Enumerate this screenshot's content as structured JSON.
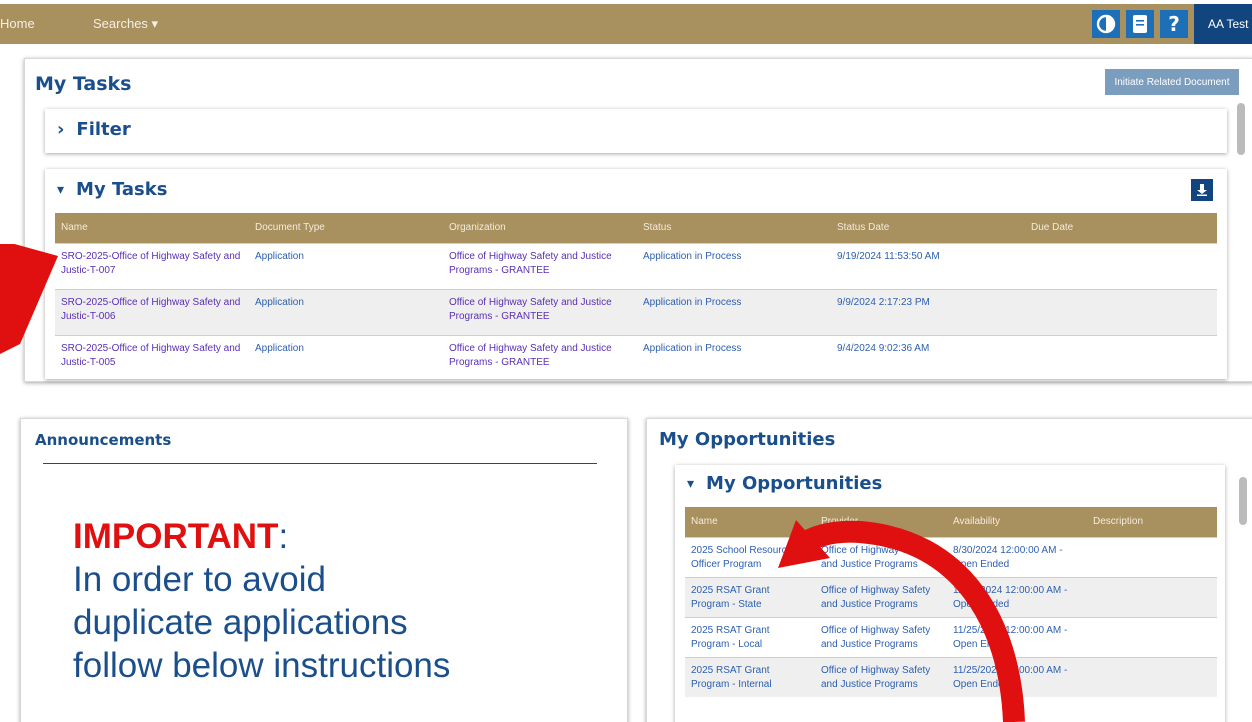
{
  "nav": {
    "home": "Home",
    "searches": "Searches ▾",
    "user": "AA Test",
    "icons": [
      "contrast-icon",
      "book-icon",
      "help-icon"
    ]
  },
  "tasks_panel": {
    "title": "My Tasks",
    "initiate_button": "Initiate Related Document",
    "filter_label": "Filter",
    "subpanel_title": "My Tasks",
    "columns": [
      "Name",
      "Document Type",
      "Organization",
      "Status",
      "Status Date",
      "Due Date"
    ],
    "rows": [
      {
        "name": "SRO-2025-Office of Highway Safety and Justic-T-007",
        "doc_type": "Application",
        "org": "Office of Highway Safety and Justice Programs - GRANTEE",
        "status": "Application in Process",
        "status_date": "9/19/2024 11:53:50 AM",
        "due_date": ""
      },
      {
        "name": "SRO-2025-Office of Highway Safety and Justic-T-006",
        "doc_type": "Application",
        "org": "Office of Highway Safety and Justice Programs - GRANTEE",
        "status": "Application in Process",
        "status_date": "9/9/2024 2:17:23 PM",
        "due_date": ""
      },
      {
        "name": "SRO-2025-Office of Highway Safety and Justic-T-005",
        "doc_type": "Application",
        "org": "Office of Highway Safety and Justice Programs - GRANTEE",
        "status": "Application in Process",
        "status_date": "9/4/2024 9:02:36 AM",
        "due_date": ""
      }
    ]
  },
  "announcements": {
    "title": "Announcements",
    "important": "IMPORTANT",
    "colon": ":",
    "lines": [
      "In order to avoid",
      "duplicate applications",
      "follow below instructions"
    ]
  },
  "opportunities": {
    "title": "My Opportunities",
    "subpanel_title": "My Opportunities",
    "columns": [
      "Name",
      "Provider",
      "Availability",
      "Description"
    ],
    "rows": [
      {
        "name": "2025 School Resource Officer Program",
        "provider": "Office of Highway Safety and Justice Programs",
        "availability": "8/30/2024 12:00:00 AM - Open Ended",
        "description": ""
      },
      {
        "name": "2025 RSAT Grant Program - State",
        "provider": "Office of Highway Safety and Justice Programs",
        "availability": "11/25/2024 12:00:00 AM - Open Ended",
        "description": ""
      },
      {
        "name": "2025 RSAT Grant Program - Local",
        "provider": "Office of Highway Safety and Justice Programs",
        "availability": "11/25/2024 12:00:00 AM - Open Ended",
        "description": ""
      },
      {
        "name": "2025 RSAT Grant Program - Internal",
        "provider": "Office of Highway Safety and Justice Programs",
        "availability": "11/25/2024 12:00:00 AM - Open Ended",
        "description": ""
      }
    ]
  },
  "colors": {
    "nav_bg": "#a9905f",
    "title_blue": "#1a4f8c",
    "link_blue": "#2d5fb1",
    "annotation_red": "#e01010"
  }
}
